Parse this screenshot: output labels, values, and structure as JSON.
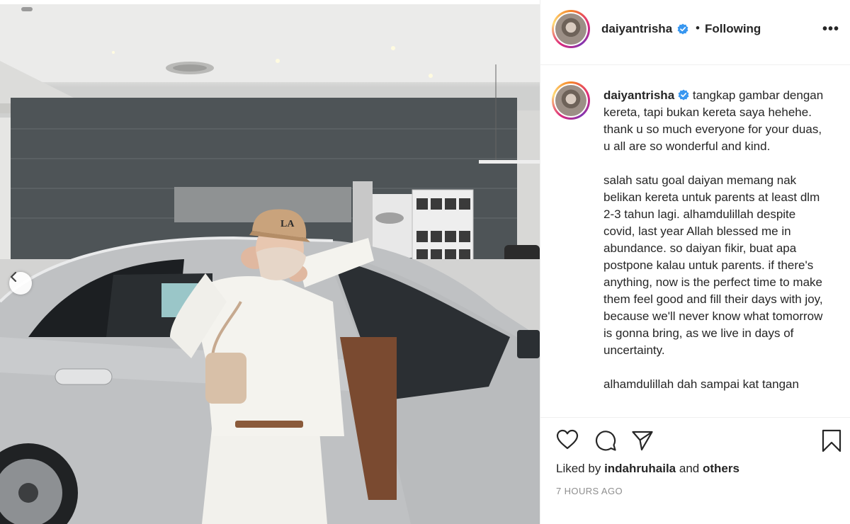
{
  "post": {
    "username": "daiyantrisha",
    "follow_status": "Following",
    "separator": "•",
    "more_label": "•••"
  },
  "caption": {
    "username": "daiyantrisha",
    "paragraph1": "tangkap gambar dengan kereta, tapi bukan kereta saya hehehe. thank u so much everyone for your duas, u all are so wonderful and kind.",
    "paragraph2": "salah satu goal daiyan memang nak belikan kereta untuk parents at least dlm 2-3 tahun lagi. alhamdulillah despite covid, last year Allah blessed me in abundance. so daiyan fikir, buat apa postpone kalau untuk parents. if there's anything, now is the perfect time to make them feel good and fill their days with joy, because we'll never know what tomorrow is gonna bring, as we live in days of uncertainty.",
    "paragraph3": "alhamdulillah dah sampai kat tangan"
  },
  "likes": {
    "prefix": "Liked by",
    "user": "indahruhaila",
    "conjunction": "and",
    "others": "others"
  },
  "timestamp": "7 HOURS AGO",
  "icons": {
    "like": "heart-icon",
    "comment": "comment-icon",
    "share": "send-icon",
    "save": "bookmark-icon",
    "verified": "verified-badge-icon",
    "prev": "chevron-left-icon"
  },
  "colors": {
    "verified_blue": "#3897f0",
    "muted_text": "#8e8e8e",
    "text": "#262626",
    "cap_color": "#c9a37c"
  }
}
